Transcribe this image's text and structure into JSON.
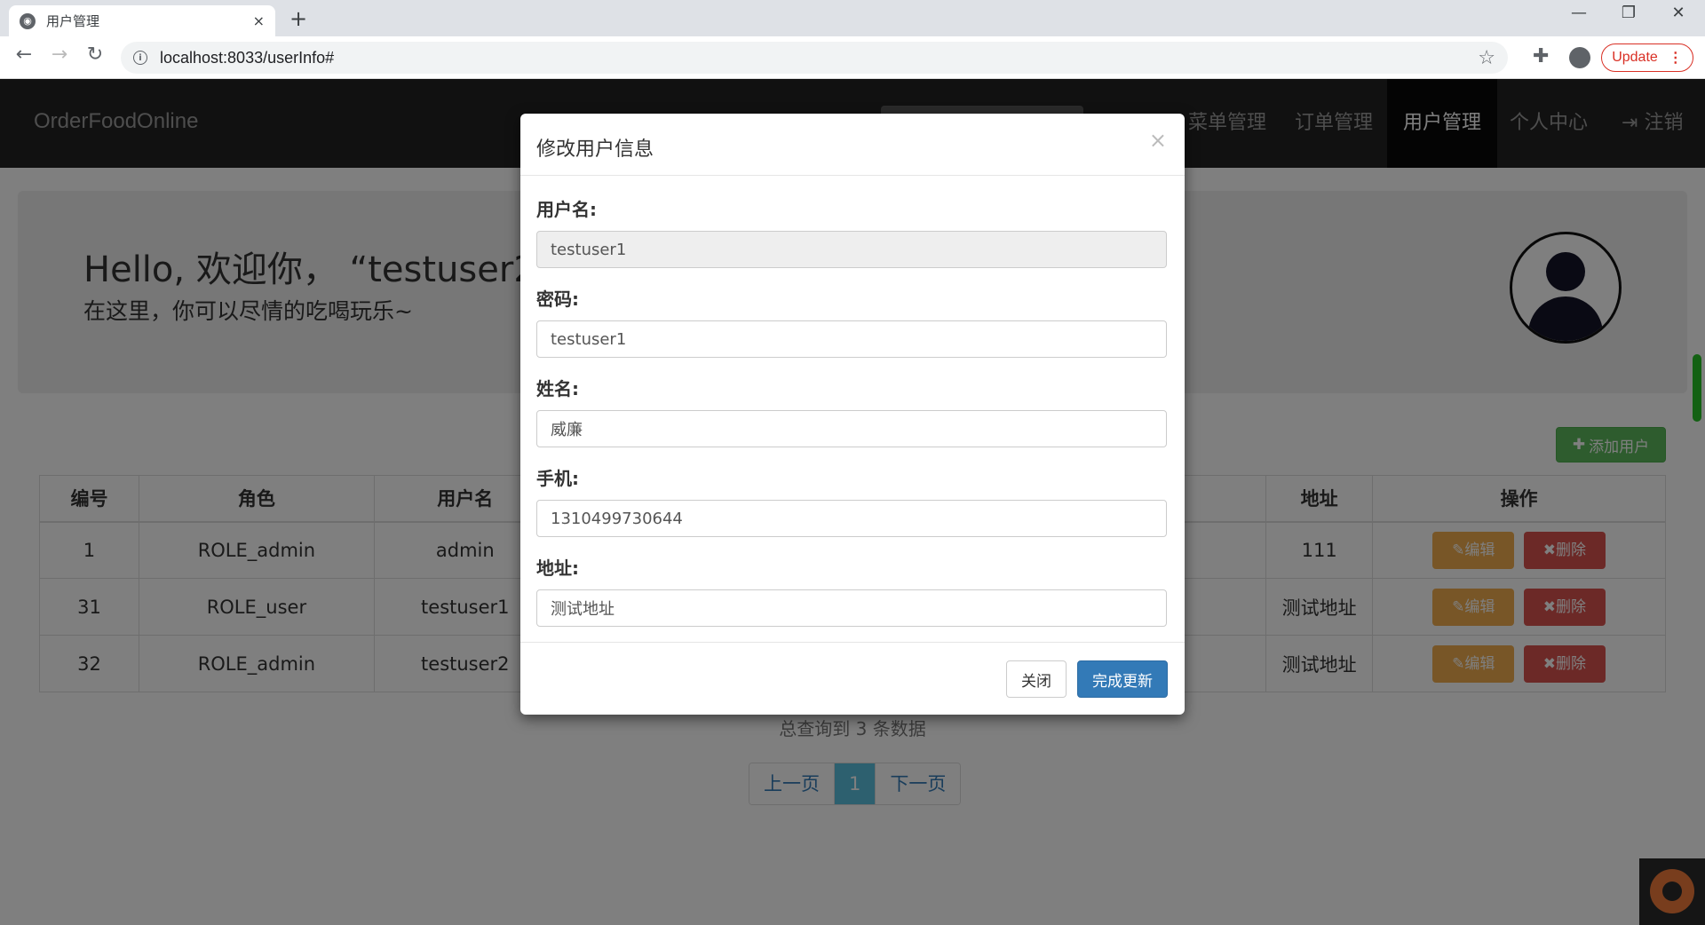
{
  "browser": {
    "tab_title": "用户管理",
    "tab_close": "×",
    "new_tab": "+",
    "url": "localhost:8033/userInfo#",
    "update_label": "Update",
    "update_menu": "⋮"
  },
  "navbar": {
    "brand": "OrderFoodOnline",
    "items": [
      {
        "label": "菜单管理"
      },
      {
        "label": "订单管理"
      },
      {
        "label": "用户管理"
      },
      {
        "label": "个人中心"
      },
      {
        "label": "注销"
      }
    ]
  },
  "jumbotron": {
    "title": "Hello, 欢迎你，  “testuser2”",
    "subtitle": "在这里，你可以尽情的吃喝玩乐~"
  },
  "toolbar": {
    "add_user_label": "添加用户"
  },
  "table": {
    "headers": [
      "编号",
      "角色",
      "用户名",
      "地址",
      "操作"
    ],
    "rows": [
      {
        "id": "1",
        "role": "ROLE_admin",
        "username": "admin",
        "address": "111"
      },
      {
        "id": "31",
        "role": "ROLE_user",
        "username": "testuser1",
        "address": "测试地址"
      },
      {
        "id": "32",
        "role": "ROLE_admin",
        "username": "testuser2",
        "address": "测试地址"
      }
    ],
    "edit_label": "编辑",
    "delete_label": "删除"
  },
  "summary": "总查询到 3 条数据",
  "pagination": {
    "prev": "上一页",
    "current": "1",
    "next": "下一页"
  },
  "modal": {
    "title": "修改用户信息",
    "close_x": "×",
    "fields": {
      "username": {
        "label": "用户名:",
        "value": "testuser1"
      },
      "password": {
        "label": "密码:",
        "value": "testuser1"
      },
      "name": {
        "label": "姓名:",
        "value": "威廉"
      },
      "phone": {
        "label": "手机:",
        "value": "1310499730644"
      },
      "address": {
        "label": "地址:",
        "value": "测试地址"
      }
    },
    "close_label": "关闭",
    "submit_label": "完成更新"
  }
}
